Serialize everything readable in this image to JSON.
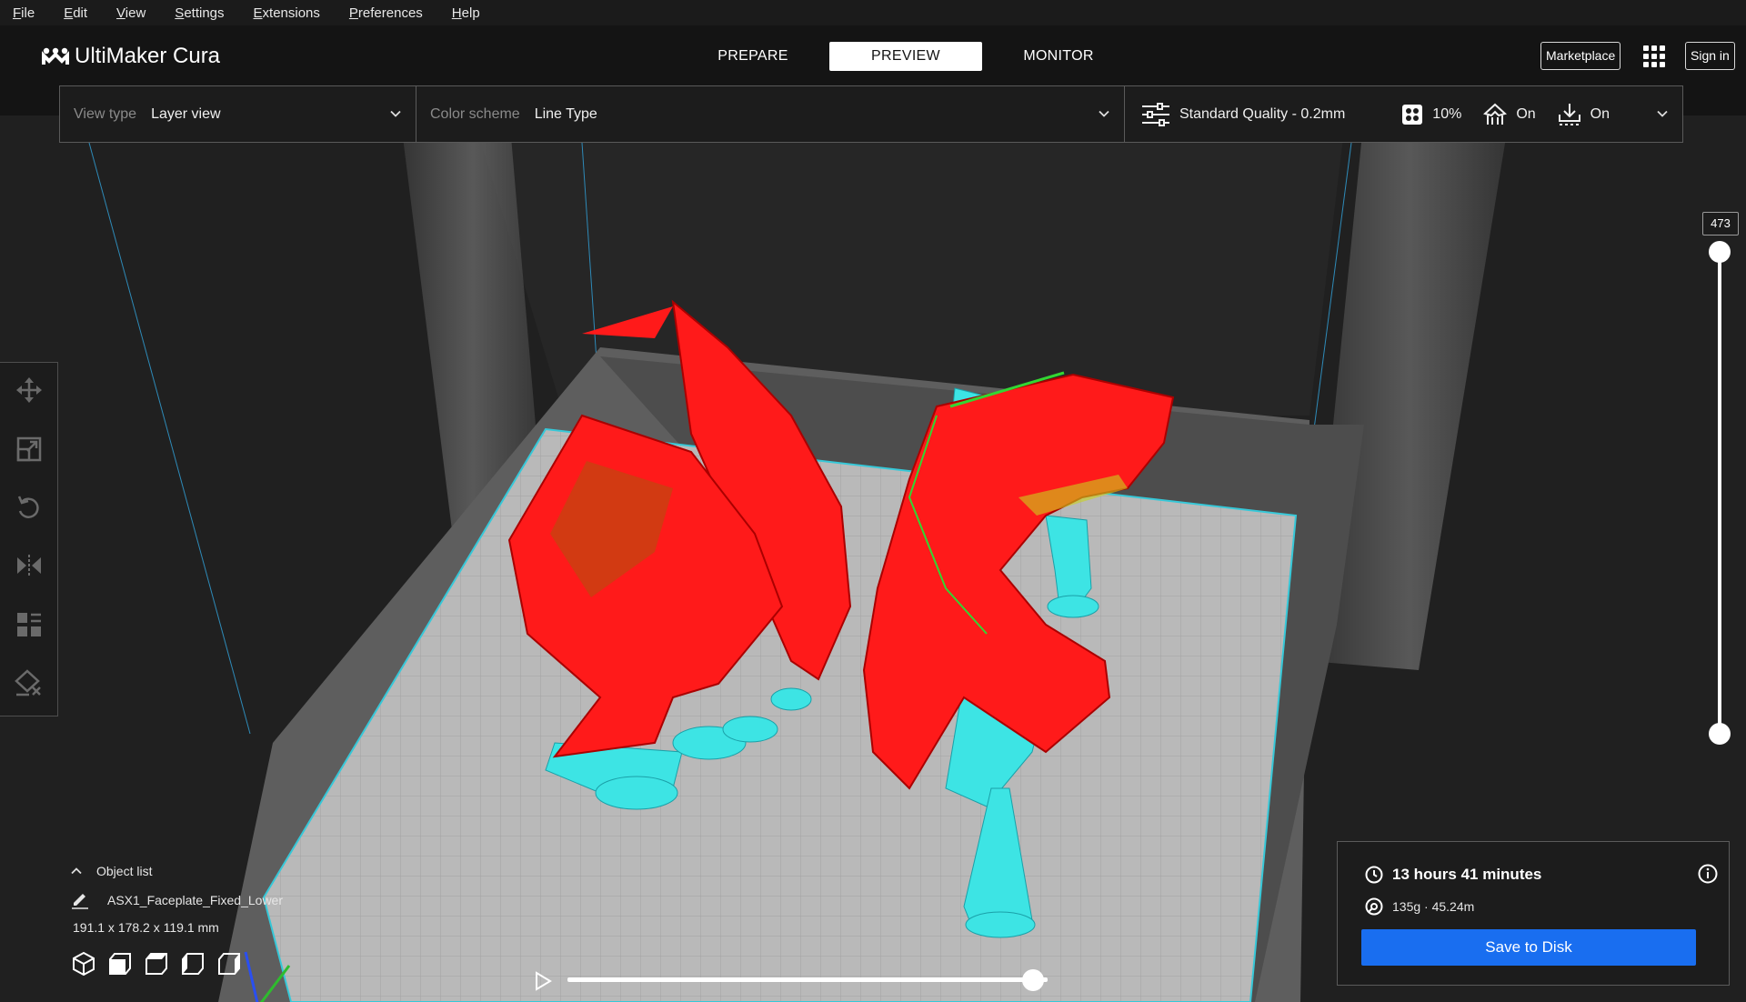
{
  "menu": [
    "File",
    "Edit",
    "View",
    "Settings",
    "Extensions",
    "Preferences",
    "Help"
  ],
  "app": {
    "name": "UltiMaker Cura"
  },
  "stages": {
    "prepare": "PREPARE",
    "preview": "PREVIEW",
    "monitor": "MONITOR",
    "active": "PREVIEW"
  },
  "header": {
    "marketplace": "Marketplace",
    "sign_in": "Sign in"
  },
  "toolbar": {
    "view_type_label": "View type",
    "view_type_value": "Layer view",
    "color_scheme_label": "Color scheme",
    "color_scheme_value": "Line Type",
    "quality": "Standard Quality - 0.2mm",
    "infill": "10%",
    "support": "On",
    "adhesion": "On"
  },
  "left_tools": [
    "move-icon",
    "scale-icon",
    "rotate-icon",
    "mirror-icon",
    "per-model-settings-icon",
    "support-blocker-icon"
  ],
  "layer_slider": {
    "value": "473",
    "top_fraction": 1.0,
    "bottom_fraction": 0.0
  },
  "object_list": {
    "title": "Object list",
    "object_name": "ASX1_Faceplate_Fixed_Lower",
    "dimensions": "191.1 x 178.2 x 119.1 mm"
  },
  "camera_views": [
    "3d-view-icon",
    "front-view-icon",
    "top-view-icon",
    "left-view-icon",
    "right-view-icon"
  ],
  "playback": {
    "progress": 0.97
  },
  "print_summary": {
    "time": "13 hours 41 minutes",
    "material": "135g · 45.24m",
    "save_button": "Save to Disk"
  },
  "colors": {
    "accent": "#196ef0",
    "wall": "#ff1a1a",
    "support": "#3de4e4",
    "inner_wall": "#33d633",
    "build_plate": "#b9b9b9"
  }
}
